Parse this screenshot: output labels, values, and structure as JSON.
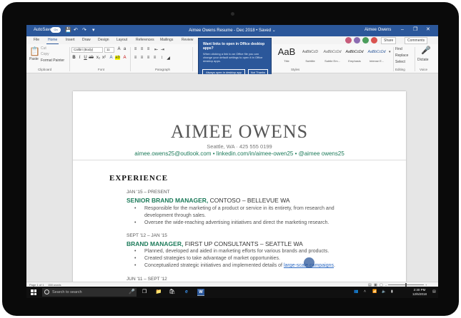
{
  "titlebar": {
    "autosave_label": "AutoSave",
    "autosave_state": "On",
    "doc_title": "Aimee Owens Resume - Dec 2018  •  Saved ⌄",
    "user_name": "Aimee Owens",
    "minimize": "–",
    "restore": "❐",
    "close": "✕"
  },
  "tabs": [
    "File",
    "Home",
    "Insert",
    "Draw",
    "Design",
    "Layout",
    "References",
    "Mailings",
    "Review"
  ],
  "active_tab": "Home",
  "top_right": {
    "share": "Share",
    "comments": "Comments"
  },
  "ribbon": {
    "paste": "Paste",
    "cut": "Cut",
    "copy": "Copy",
    "format_painter": "Format Painter",
    "font_name": "Calibri (Body)",
    "font_size": "11",
    "group_clipboard": "Clipboard",
    "group_font": "Font",
    "group_paragraph": "Paragraph",
    "group_styles": "Styles",
    "group_editing": "Editing",
    "group_voice": "Voice",
    "styles": [
      {
        "sample": "AaB",
        "name": "Title"
      },
      {
        "sample": "AaBbCcD",
        "name": "Subtitle"
      },
      {
        "sample": "AaBbCcDd",
        "name": "Subtle Em..."
      },
      {
        "sample": "AaBbCcDd",
        "name": "Emphasis"
      },
      {
        "sample": "AaBbCcDd",
        "name": "Intense E..."
      }
    ],
    "find": "Find",
    "replace": "Replace",
    "select": "Select",
    "dictate": "Dictate"
  },
  "popup": {
    "title": "Want links to open in Office desktop apps?",
    "body": "When clicking a link to an Office file you can change your default settings to open it in Office desktop apps.",
    "primary_button": "Always open in desktop app",
    "secondary_button": "Not Thanks"
  },
  "resume": {
    "name": "AIMEE OWENS",
    "contact": "Seattle, WA · 425 555 0199",
    "links": "aimee.owens25@outlook.com • linkedin.com/in/aimee-owen25 • @aimee owens25",
    "section": "EXPERIENCE",
    "jobs": [
      {
        "dates": "JAN '15 – PRESENT",
        "title": "SENIOR BRAND MANAGER,",
        "company": " CONTOSO – BELLEVUE WA",
        "bullets": [
          "Responsible for the marketing of a product or service in its entirety, from research and development through sales.",
          "Oversee the wide-reaching advertising initiatives and direct the marketing research."
        ]
      },
      {
        "dates": "SEPT '12 – JAN '15",
        "title": "BRAND MANAGER,",
        "company": " FIRST UP CONSULTANTS – SEATTLE WA",
        "bullets": [
          "Planned, developed and aided in marketing efforts for various brands and products.",
          "Created strategies to take advantage of market opportunities.",
          "Conceptualized strategic initiatives and implemented details of "
        ],
        "last_link": "large-scale campaigns",
        "last_tail": "."
      },
      {
        "dates": "JUN '11 – SEPT '12"
      }
    ]
  },
  "status": {
    "page": "Page 1 of 1",
    "words": "158 words"
  },
  "taskbar": {
    "search_placeholder": "Search to search",
    "time": "2:30 PM",
    "date": "12/5/2018"
  },
  "colors": {
    "word_blue": "#2b579a",
    "resume_green": "#1d7b5a",
    "link_blue": "#2e6bc4"
  }
}
